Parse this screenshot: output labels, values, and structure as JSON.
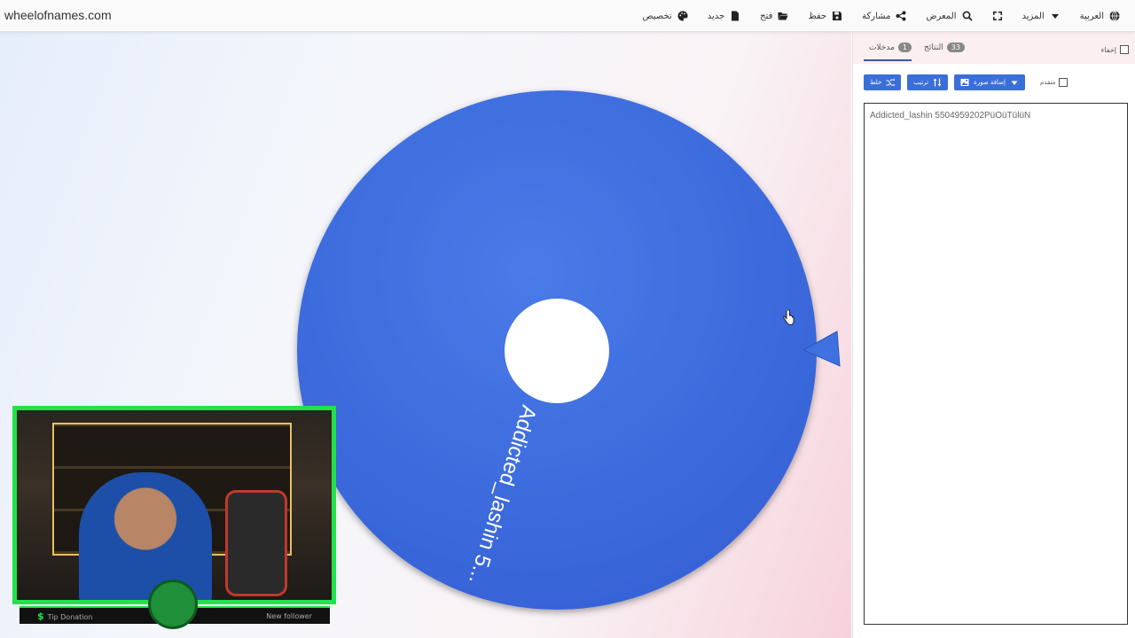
{
  "site": {
    "title": "wheelofnames.com"
  },
  "menu": [
    {
      "label": "العربية",
      "icon": "globe-icon"
    },
    {
      "label": "المزيد",
      "icon": "caret-down-icon"
    },
    {
      "label": "",
      "icon": "fullscreen-icon"
    },
    {
      "label": "المعرض",
      "icon": "search-icon"
    },
    {
      "label": "مشاركة",
      "icon": "share-icon"
    },
    {
      "label": "حفظ",
      "icon": "save-icon"
    },
    {
      "label": "فتح",
      "icon": "folder-open-icon"
    },
    {
      "label": "جديد",
      "icon": "new-file-icon"
    },
    {
      "label": "تخصيص",
      "icon": "palette-icon"
    }
  ],
  "wheel": {
    "color": "#3d6fe0",
    "segment_label": "Addicted_lashin 5..."
  },
  "panel": {
    "hide_label": "إخفاء",
    "tabs": {
      "entries_label": "مدخلات",
      "entries_count": "1",
      "results_label": "النتائج",
      "results_count": "33"
    },
    "toolbar": {
      "shuffle": "خلط",
      "sort": "ترتيب",
      "add_image": "إضافة صورة",
      "advanced": "متقدم"
    },
    "entries_text": "Addicted_lashin 5504959202PüOüTülüN"
  },
  "stream_overlay": {
    "tip_label": "Tip Donation",
    "tip_symbol": "$",
    "follower_label": "New follower"
  },
  "colors": {
    "accent": "#3b6fd8",
    "cam_border": "#22e24a",
    "tab_bg": "#fbeff2"
  }
}
